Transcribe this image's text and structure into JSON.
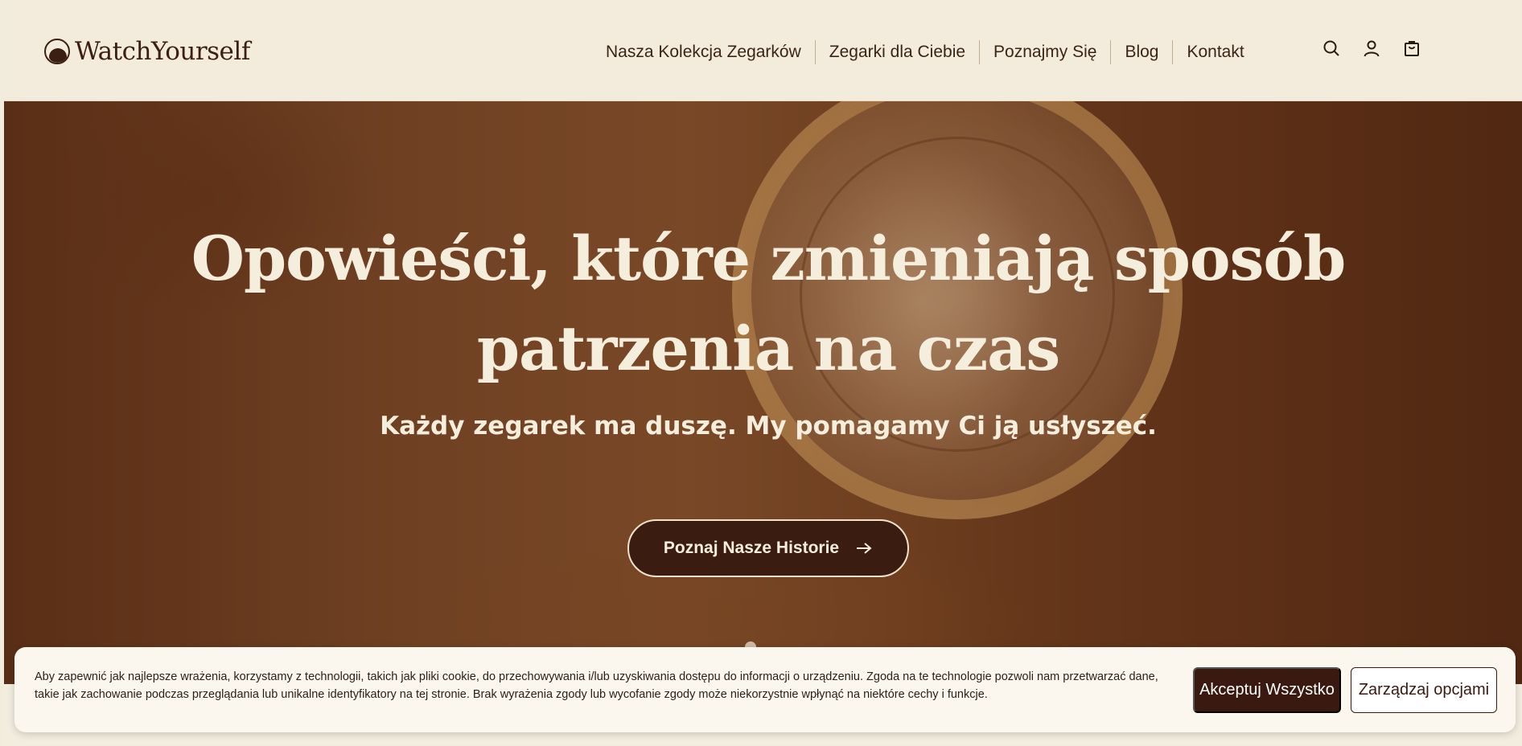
{
  "brand": {
    "logo_text": "WatchYourself"
  },
  "nav": {
    "items": [
      {
        "label": "Nasza Kolekcja Zegarków"
      },
      {
        "label": "Zegarki dla Ciebie"
      },
      {
        "label": "Poznajmy Się"
      },
      {
        "label": "Blog"
      },
      {
        "label": "Kontakt"
      }
    ]
  },
  "header_icons": [
    "search-icon",
    "user-icon",
    "cart-icon"
  ],
  "hero": {
    "title": "Opowieści, które zmieniają sposób patrzenia na czas",
    "subtitle": "Każdy zegarek ma duszę. My pomagamy Ci ją usłyszeć.",
    "cta_label": "Poznaj Nasze Historie"
  },
  "cookie": {
    "text": "Aby zapewnić jak najlepsze wrażenia, korzystamy z technologii, takich jak pliki cookie, do przechowywania i/lub uzyskiwania dostępu do informacji o urządzeniu. Zgoda na te technologie pozwoli nam przetwarzać dane, takie jak zachowanie podczas przeglądania lub unikalne identyfikatory na tej stronie. Brak wyrażenia zgody lub wycofanie zgody może niekorzystnie wpłynąć na niektóre cechy i funkcje.",
    "accept_label": "Akceptuj Wszystko",
    "manage_label": "Zarządzaj opcjami"
  },
  "colors": {
    "header_bg": "#f3ecdc",
    "brand_dark": "#3b1f12",
    "cta_bg": "#3a1d10",
    "hero_text": "#f6eedd"
  }
}
